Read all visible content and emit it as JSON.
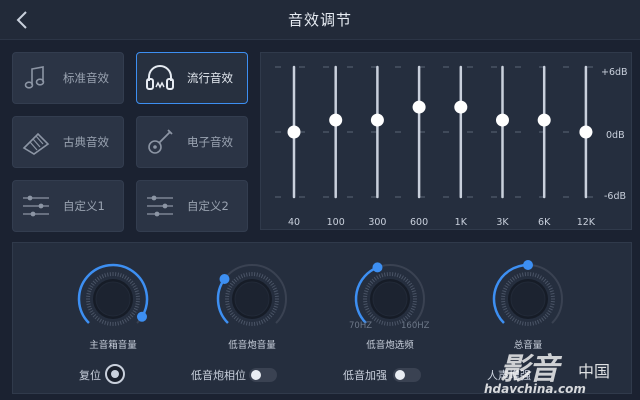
{
  "header": {
    "title": "音效调节"
  },
  "presets": [
    {
      "label": "标准音效",
      "icon": "music-note-icon",
      "active": false
    },
    {
      "label": "流行音效",
      "icon": "headphones-icon",
      "active": true
    },
    {
      "label": "古典音效",
      "icon": "harp-icon",
      "active": false
    },
    {
      "label": "电子音效",
      "icon": "guitar-icon",
      "active": false
    },
    {
      "label": "自定义1",
      "icon": "sliders-icon",
      "active": false
    },
    {
      "label": "自定义2",
      "icon": "sliders-icon",
      "active": false
    }
  ],
  "equalizer": {
    "db_labels": {
      "top": "+6dB",
      "mid": "0dB",
      "bottom": "-6dB"
    },
    "range_db": [
      -6,
      6
    ],
    "bands": [
      {
        "freq": "40",
        "gain_db": 0
      },
      {
        "freq": "100",
        "gain_db": 1.1
      },
      {
        "freq": "300",
        "gain_db": 1.1
      },
      {
        "freq": "600",
        "gain_db": 2.3
      },
      {
        "freq": "1K",
        "gain_db": 2.3
      },
      {
        "freq": "3K",
        "gain_db": 1.1
      },
      {
        "freq": "6K",
        "gain_db": 1.1
      },
      {
        "freq": "12K",
        "gain_db": 0
      }
    ]
  },
  "knobs": [
    {
      "label": "主音箱音量",
      "level": 0.95,
      "min_label": "",
      "max_label": ""
    },
    {
      "label": "低音炮音量",
      "level": 0.3,
      "min_label": "",
      "max_label": ""
    },
    {
      "label": "低音炮选频",
      "level": 0.42,
      "min_label": "70HZ",
      "max_label": "160HZ"
    },
    {
      "label": "总音量",
      "level": 0.5,
      "min_label": "",
      "max_label": ""
    }
  ],
  "controls": {
    "reset_label": "复位",
    "sub_phase_label": "低音炮相位",
    "bass_boost_label": "低音加强",
    "vocal_label": "人声增强"
  },
  "watermark": {
    "brand": "影音",
    "cn": "中国",
    "site": "hdavchina.com"
  },
  "colors": {
    "accent": "#3d8ff2",
    "slider_top": "#8f5bd8",
    "slider_bottom": "#3b46c8"
  }
}
